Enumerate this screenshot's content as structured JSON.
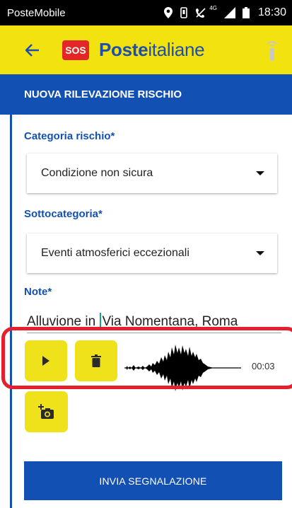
{
  "status_bar": {
    "carrier": "PosteMobile",
    "network": "4G",
    "time": "18:30"
  },
  "app_bar": {
    "sos_label": "SOS",
    "brand_bold": "Poste",
    "brand_light": "italiane"
  },
  "section": {
    "title": "NUOVA RILEVAZIONE RISCHIO"
  },
  "form": {
    "categoria": {
      "label": "Categoria rischio*",
      "value": "Condizione non sicura"
    },
    "sottocategoria": {
      "label": "Sottocategoria*",
      "value": "Eventi atmosferici eccezionali"
    },
    "note": {
      "label": "Note*",
      "value_before_cursor": "Alluvione in ",
      "value_after_cursor": "Via Nomentana, Roma"
    }
  },
  "audio": {
    "duration": "00:03"
  },
  "actions": {
    "send_label": "INVIA SEGNALAZIONE"
  },
  "colors": {
    "primary_blue": "#1350b3",
    "brand_yellow": "#f2e20f",
    "highlight_red": "#e5202e",
    "sos_red": "#e32726"
  }
}
